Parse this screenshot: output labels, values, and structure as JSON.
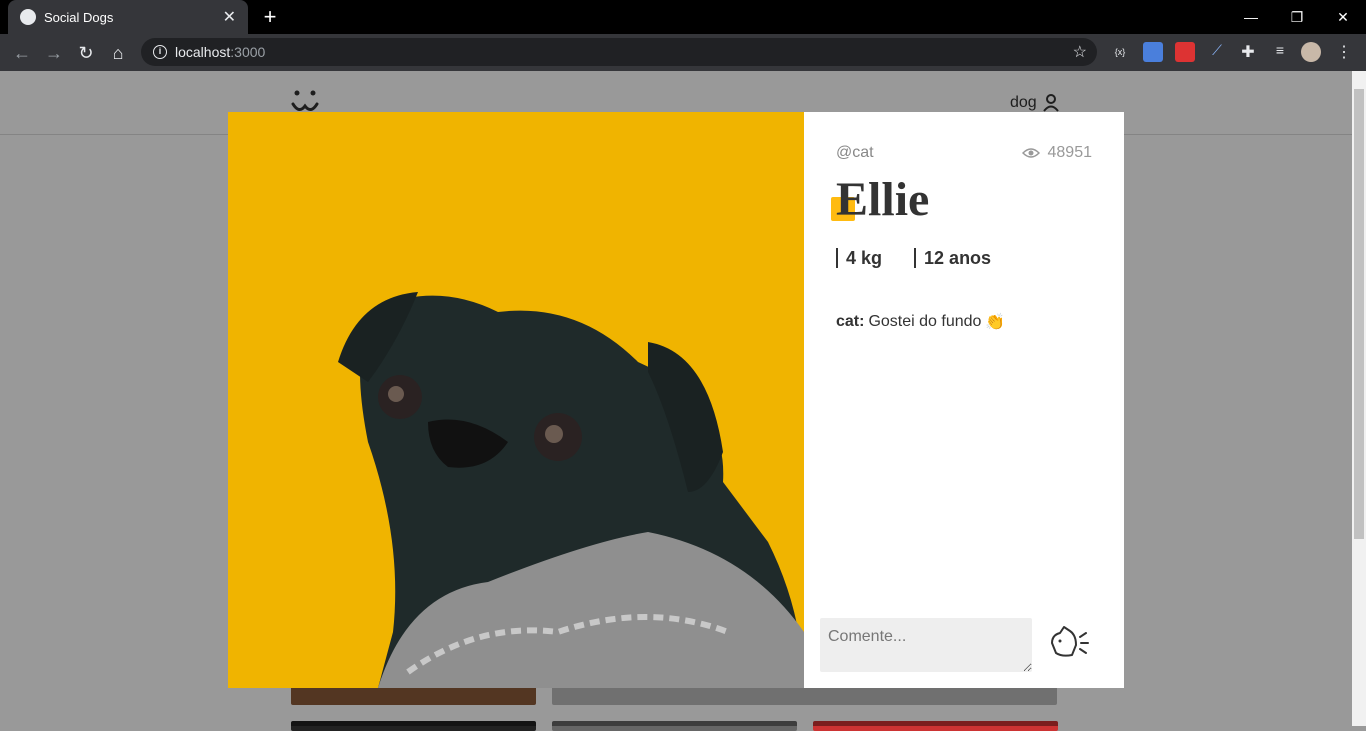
{
  "browser": {
    "tab_title": "Social Dogs",
    "address_host": "localhost",
    "address_port": ":3000"
  },
  "site": {
    "user_label": "dog"
  },
  "photo": {
    "author": "@cat",
    "views": "48951",
    "title": "Ellie",
    "weight": "4 kg",
    "age": "12 anos",
    "comments": [
      {
        "author": "cat:",
        "text": "Gostei do fundo",
        "emoji": "👏"
      }
    ],
    "comment_placeholder": "Comente..."
  },
  "colors": {
    "accent": "#ffbb11",
    "photo_background": "#f0b400"
  }
}
